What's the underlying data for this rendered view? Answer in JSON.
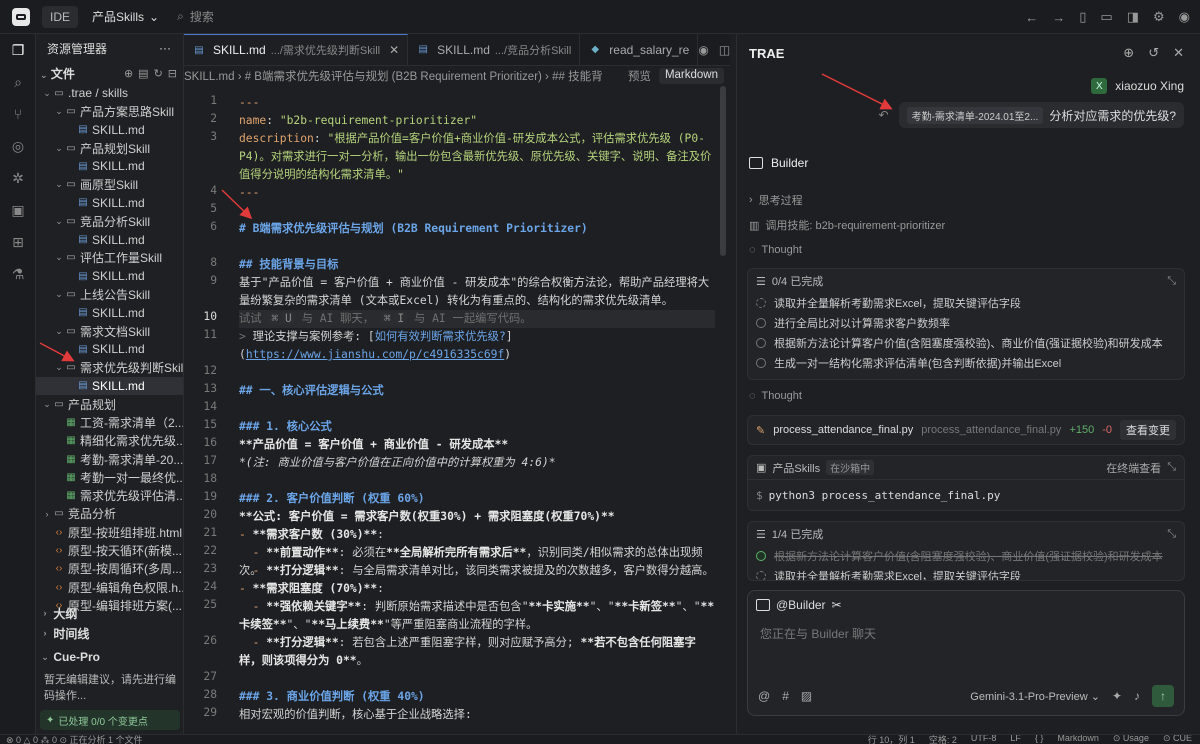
{
  "topbar": {
    "ide": "IDE",
    "project": "产品Skills",
    "search": "搜索"
  },
  "explorer": {
    "title": "资源管理器",
    "files_label": "文件",
    "tree": [
      {
        "label": ".trae / skills",
        "depth": 0,
        "kind": "folder",
        "open": true
      },
      {
        "label": "产品方案思路Skill",
        "depth": 1,
        "kind": "folder",
        "open": true
      },
      {
        "label": "SKILL.md",
        "depth": 2,
        "kind": "md"
      },
      {
        "label": "产品规划Skill",
        "depth": 1,
        "kind": "folder",
        "open": true
      },
      {
        "label": "SKILL.md",
        "depth": 2,
        "kind": "md"
      },
      {
        "label": "画原型Skill",
        "depth": 1,
        "kind": "folder",
        "open": true
      },
      {
        "label": "SKILL.md",
        "depth": 2,
        "kind": "md"
      },
      {
        "label": "竞品分析Skill",
        "depth": 1,
        "kind": "folder",
        "open": true
      },
      {
        "label": "SKILL.md",
        "depth": 2,
        "kind": "md"
      },
      {
        "label": "评估工作量Skill",
        "depth": 1,
        "kind": "folder",
        "open": true
      },
      {
        "label": "SKILL.md",
        "depth": 2,
        "kind": "md"
      },
      {
        "label": "上线公告Skill",
        "depth": 1,
        "kind": "folder",
        "open": true
      },
      {
        "label": "SKILL.md",
        "depth": 2,
        "kind": "md"
      },
      {
        "label": "需求文档Skill",
        "depth": 1,
        "kind": "folder",
        "open": true
      },
      {
        "label": "SKILL.md",
        "depth": 2,
        "kind": "md"
      },
      {
        "label": "需求优先级判断Skill",
        "depth": 1,
        "kind": "folder",
        "open": true
      },
      {
        "label": "SKILL.md",
        "depth": 2,
        "kind": "md",
        "selected": true
      },
      {
        "label": "产品规划",
        "depth": 0,
        "kind": "folder",
        "open": true
      },
      {
        "label": "工资-需求清单（2...",
        "depth": 1,
        "kind": "xls"
      },
      {
        "label": "精细化需求优先级...",
        "depth": 1,
        "kind": "xls"
      },
      {
        "label": "考勤-需求清单-20...",
        "depth": 1,
        "kind": "xls"
      },
      {
        "label": "考勤一对一最终优...",
        "depth": 1,
        "kind": "xls"
      },
      {
        "label": "需求优先级评估清...",
        "depth": 1,
        "kind": "xls"
      },
      {
        "label": "竞品分析",
        "depth": 0,
        "kind": "folder",
        "open": false
      },
      {
        "label": "原型-按班组排班.html",
        "depth": 0,
        "kind": "html"
      },
      {
        "label": "原型-按天循环(新模...",
        "depth": 0,
        "kind": "html"
      },
      {
        "label": "原型-按周循环(多周...",
        "depth": 0,
        "kind": "html"
      },
      {
        "label": "原型-编辑角色权限.h...",
        "depth": 0,
        "kind": "html"
      },
      {
        "label": "原型-编辑排班方案(...",
        "depth": 0,
        "kind": "html"
      }
    ],
    "outline": "大纲",
    "timeline": "时间线",
    "cue_title": "Cue-Pro",
    "cue_text": "暂无编辑建议，请先进行编码操作...",
    "cue_status": "已处理 0/0 个变更点"
  },
  "editor": {
    "tabs": [
      {
        "name": "SKILL.md",
        "path": ".../需求优先级判断Skill",
        "active": true
      },
      {
        "name": "SKILL.md",
        "path": ".../竞品分析Skill",
        "active": false
      },
      {
        "name": "read_salary_re",
        "path": "",
        "active": false
      }
    ],
    "breadcrumb": "SKILL.md › # B端需求优先级评估与规划 (B2B Requirement Prioritizer) › ## 技能背",
    "preview": "预览",
    "markdown": "Markdown"
  },
  "chat": {
    "title": "TRAE",
    "user": "xiaozuo Xing",
    "user_initial": "X",
    "msg_chip": "考勤-需求清单-2024.01至2...",
    "msg_text": "分析对应需求的优先级?",
    "builder": "Builder",
    "thinking": "思考过程",
    "skill_used": "调用技能: b2b-requirement-prioritizer",
    "thought": "Thought",
    "todo1_head": "0/4 已完成",
    "todo1": [
      "读取并全量解析考勤需求Excel，提取关键评估字段",
      "进行全局比对以计算需求客户数频率",
      "根据新方法论计算客户价值(含阻塞度强校验)、商业价值(强证据校验)和研发成本",
      "生成一对一结构化需求评估清单(包含判断依据)并输出Excel"
    ],
    "thought2": "Thought",
    "file_name": "process_attendance_final.py",
    "file_path": "process_attendance_final.py",
    "file_add": "+150",
    "file_del": "-0",
    "view_changes": "查看变更",
    "term_label": "产品Skills",
    "sandbox": "在沙箱中",
    "open_terminal": "在终端查看",
    "command": "python3 process_attendance_final.py",
    "todo2_head": "1/4 已完成",
    "todo2": [
      "根据新方法论计算客户价值(含阻塞度强校验)、商业价值(强证据校验)和研发成本",
      "读取并全量解析考勤需求Excel，提取关键评估字段"
    ],
    "input_agent": "@Builder",
    "input_placeholder": "您正在与 Builder 聊天",
    "model": "Gemini-3.1-Pro-Preview"
  },
  "status": {
    "left": "⊗ 0 △ 0 ⁂ 0   ⊙ 正在分析 1 个文件",
    "right": [
      "行 10，列 1",
      "空格: 2",
      "UTF-8",
      "LF",
      "{ }",
      "Markdown",
      "⊙ Usage",
      "⊙ CUE"
    ]
  }
}
